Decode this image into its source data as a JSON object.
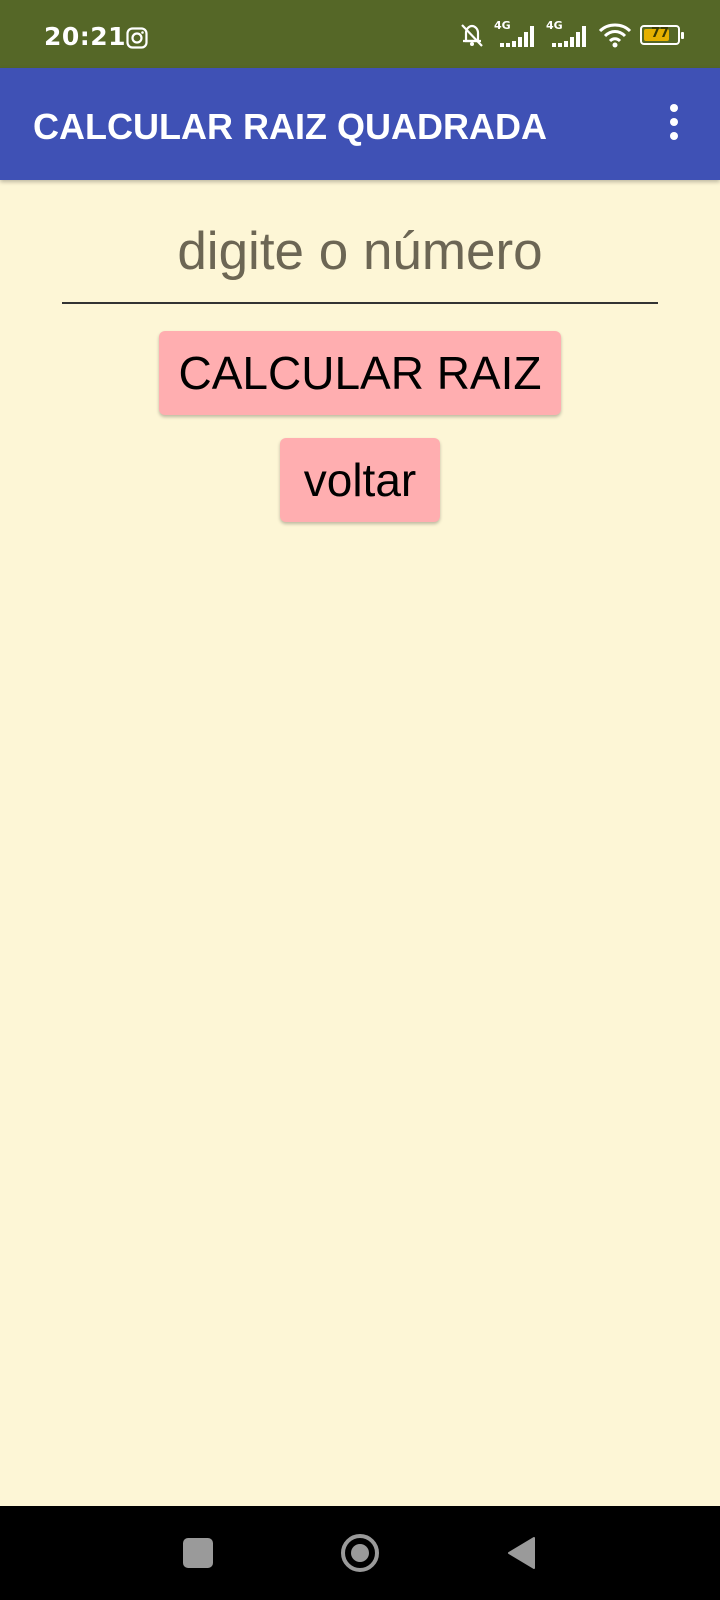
{
  "status_bar": {
    "time": "20:21",
    "network_tag_1": "4G",
    "network_tag_2": "4G",
    "battery_percent": "77",
    "battery_level": 0.77,
    "icons": [
      "instagram-icon",
      "bell-muted-icon",
      "signal-icon",
      "signal-icon",
      "wifi-icon",
      "battery-icon"
    ]
  },
  "app_bar": {
    "title": "CALCULAR RAIZ QUADRADA",
    "menu_icon": "more-vert-icon"
  },
  "form": {
    "input_placeholder": "digite o número",
    "input_value": ""
  },
  "buttons": {
    "calculate_label": "CALCULAR RAIZ",
    "back_label": "voltar"
  },
  "nav_bar": {
    "icons": [
      "recents-icon",
      "home-icon",
      "back-icon"
    ]
  },
  "colors": {
    "status_bar": "#556727",
    "app_bar": "#3f51b5",
    "background": "#fdf6d6",
    "button": "#ffaeb0",
    "nav_bar": "#000000"
  }
}
